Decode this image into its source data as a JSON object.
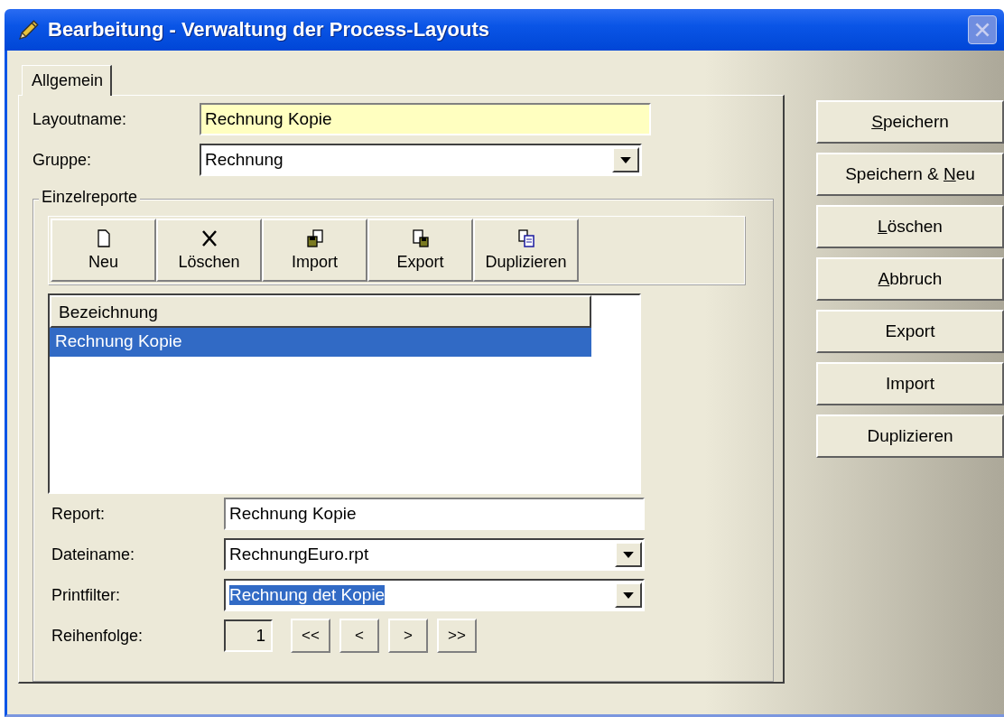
{
  "window": {
    "title": "Bearbeitung - Verwaltung der Process-Layouts"
  },
  "tabs": [
    {
      "label": "Allgemein",
      "selected": true
    }
  ],
  "layoutname": {
    "label": "Layoutname:",
    "value": "Rechnung Kopie"
  },
  "gruppe": {
    "label": "Gruppe:",
    "value": "Rechnung"
  },
  "einzelreporte": {
    "title": "Einzelreporte",
    "toolbar": [
      {
        "kind": "new",
        "label": "Neu"
      },
      {
        "kind": "delete",
        "label": "Löschen"
      },
      {
        "kind": "import",
        "label": "Import"
      },
      {
        "kind": "export",
        "label": "Export"
      },
      {
        "kind": "duplicate",
        "label": "Duplizieren"
      }
    ],
    "list": {
      "column": "Bezeichnung",
      "rows": [
        {
          "text": "Rechnung Kopie",
          "selected": true
        }
      ]
    },
    "report": {
      "label": "Report:",
      "value": "Rechnung Kopie"
    },
    "dateiname": {
      "label": "Dateiname:",
      "value": "RechnungEuro.rpt"
    },
    "printfilter": {
      "label": "Printfilter:",
      "value": "Rechnung det Kopie",
      "selected_text": true
    },
    "reihenfolge": {
      "label": "Reihenfolge:",
      "value": "1",
      "nav": [
        "<<",
        "<",
        ">",
        ">>"
      ]
    }
  },
  "buttons": [
    {
      "key": "S",
      "after": "peichern"
    },
    {
      "before": "Speichern & ",
      "key": "N",
      "after": "eu"
    },
    {
      "key": "L",
      "after": "öschen"
    },
    {
      "key": "A",
      "after": "bbruch"
    },
    {
      "before": "Export"
    },
    {
      "before": "Import"
    },
    {
      "before": "Duplizieren"
    }
  ]
}
